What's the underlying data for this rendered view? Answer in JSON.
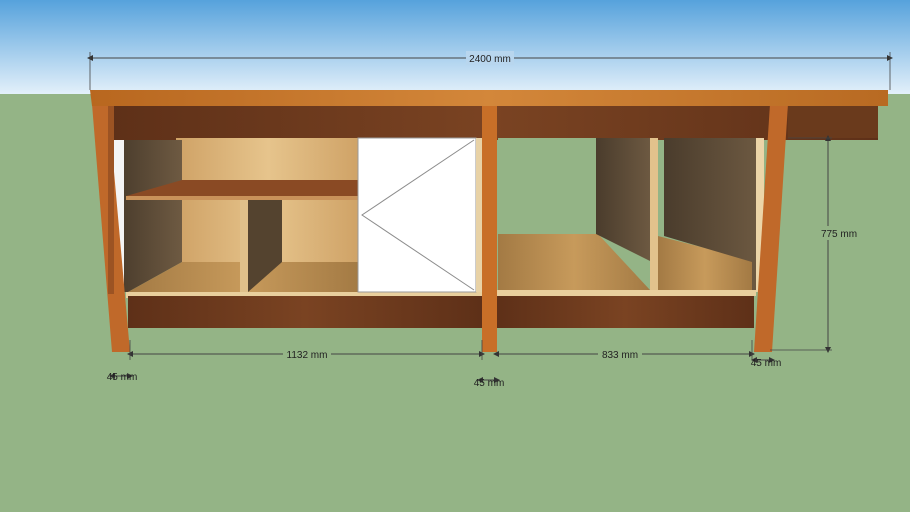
{
  "dimensions": {
    "overall_width": "2400 mm",
    "height": "775 mm",
    "left_bay": "1132 mm",
    "right_bay": "833 mm",
    "leg_left": "45 mm",
    "leg_middle": "45 mm",
    "leg_right": "45 mm"
  },
  "colors": {
    "sky_top": "#5aa5dd",
    "sky_bottom": "#dcecf8",
    "ground": "#94b486",
    "top_wood": "#c8772a",
    "apron_wood": "#6b3a1c",
    "leg_wood": "#c86f28",
    "panel_dark": "#5a4a38",
    "panel_light": "#d9b27a",
    "door": "#ffffff"
  }
}
